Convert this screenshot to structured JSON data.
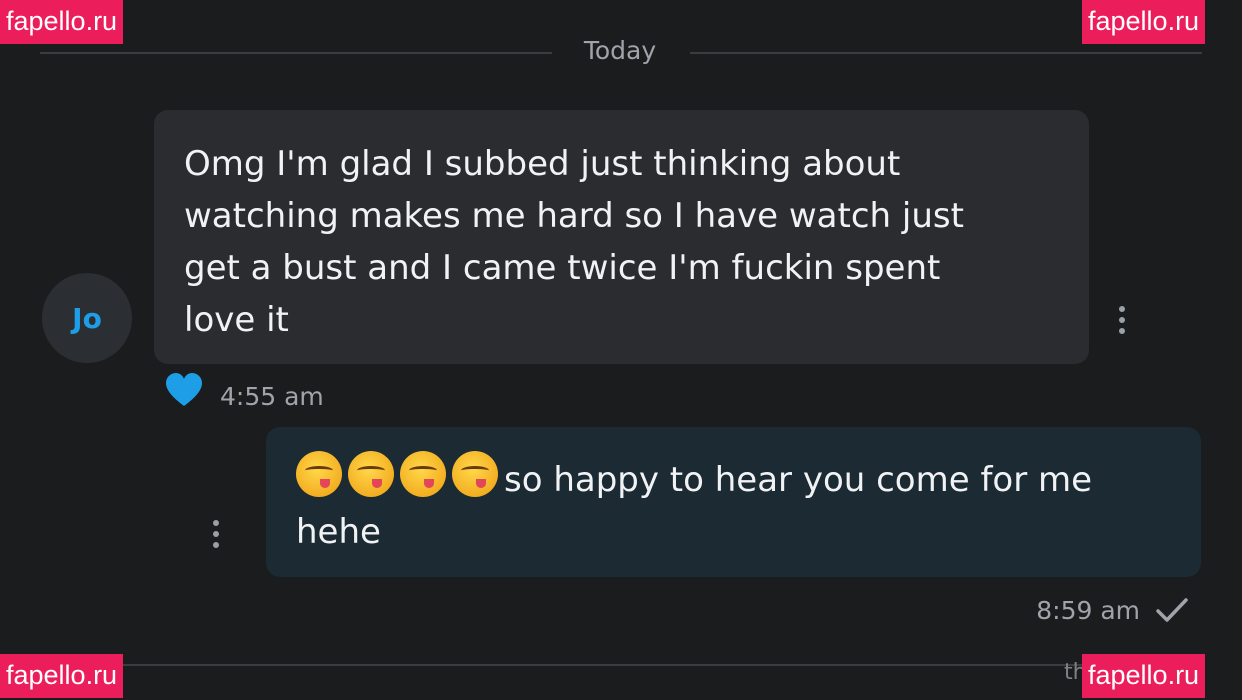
{
  "date_divider": {
    "label": "Today"
  },
  "contact": {
    "initials": "Jo"
  },
  "messages": [
    {
      "direction": "incoming",
      "text": "Omg I'm glad I subbed just thinking about\nwatching makes me hard so I have watch just\nget a bust and I came twice I'm fuckin spent\nlove it",
      "time": "4:55 am",
      "reaction_icon": "heart-icon"
    },
    {
      "direction": "outgoing",
      "emoji_icon": "face-savoring-food-emoji",
      "emoji_count": 4,
      "text": "so happy to hear you come for me\nhehe",
      "time": "8:59 am",
      "status_icon": "check-icon"
    }
  ],
  "bottom_caption": "th",
  "watermarks": [
    "fapello.ru",
    "fapello.ru",
    "fapello.ru",
    "fapello.ru"
  ],
  "colors": {
    "background": "#1b1c1e",
    "incoming_bubble": "#2b2c2f",
    "outgoing_bubble": "#1b2a33",
    "accent": "#1e9ee6",
    "watermark": "#ec1d5b"
  }
}
